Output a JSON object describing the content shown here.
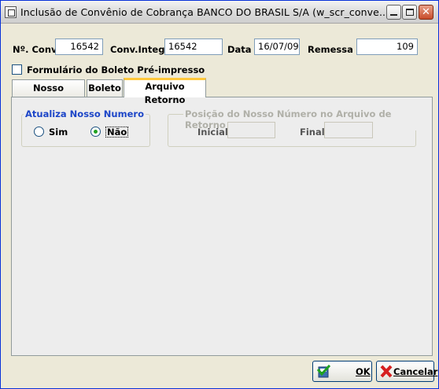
{
  "window": {
    "title": "Inclusão de Convênio de Cobrança BANCO DO BRASIL S/A (w_scr_conve...",
    "minimize_glyph": "_",
    "maximize_glyph": "□",
    "close_glyph": "✕"
  },
  "header": {
    "conv_label": "Nº. Conv.:",
    "conv_value": "16542",
    "conv_integ_label": "Conv.Integ.:",
    "conv_integ_value": "16542",
    "data_label": "Data :",
    "data_value": "16/07/09",
    "remessa_label": "Remessa :",
    "remessa_value": "109"
  },
  "checkbox": {
    "label": "Formulário do Boleto Pré-impresso",
    "checked": false
  },
  "tabs": [
    {
      "label": "Nosso Número",
      "active": false
    },
    {
      "label": "Boleto",
      "active": false
    },
    {
      "label": "Arquivo Retorno",
      "active": true
    }
  ],
  "atualiza_group": {
    "title": "Atualiza Nosso Numero",
    "title_color": "#1d46c8",
    "options": [
      {
        "label": "Sim",
        "selected": false
      },
      {
        "label": "Não",
        "selected": true
      }
    ]
  },
  "posicao_group": {
    "title": "Posição do Nosso Número no Arquivo de Retorno",
    "inicial_label": "Inicial:",
    "inicial_value": "",
    "final_label": "Final:",
    "final_value": ""
  },
  "buttons": {
    "ok_label": "OK",
    "cancel_label": "Cancelar"
  }
}
